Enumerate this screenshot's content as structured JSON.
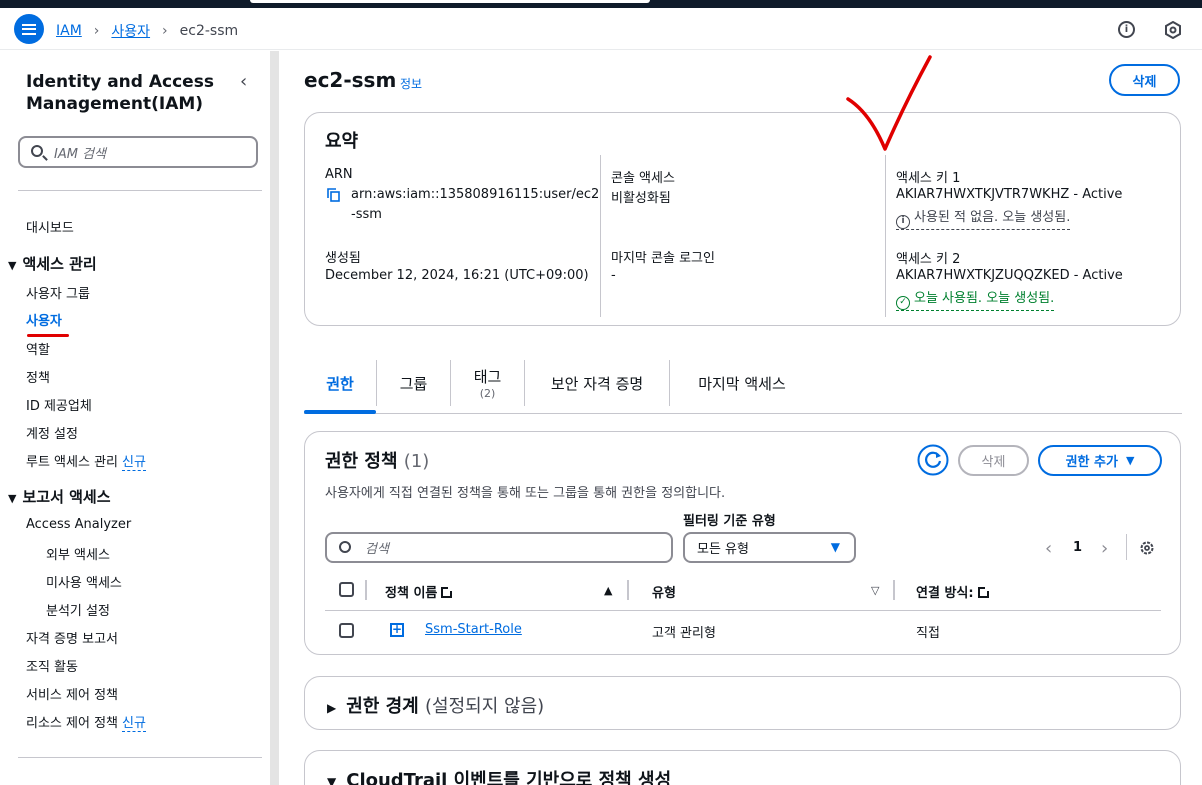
{
  "breadcrumb": {
    "iam": "IAM",
    "users": "사용자",
    "current": "ec2-ssm"
  },
  "sidebar": {
    "title": "Identity and Access Management(IAM)",
    "search_placeholder": "IAM 검색",
    "dashboard": "대시보드",
    "access_mgmt": "액세스 관리",
    "user_groups": "사용자 그룹",
    "users": "사용자",
    "roles": "역할",
    "policies": "정책",
    "id_providers": "ID 제공업체",
    "account_settings": "계정 설정",
    "root_access": "루트 액세스 관리",
    "new_label": "신규",
    "reports": "보고서 액세스",
    "access_analyzer": "Access Analyzer",
    "external_access": "외부 액세스",
    "unused_access": "미사용 액세스",
    "analyzer_settings": "분석기 설정",
    "cred_report": "자격 증명 보고서",
    "org_activity": "조직 활동",
    "scp": "서비스 제어 정책",
    "rcp": "리소스 제어 정책",
    "rcp_new": "신규"
  },
  "page": {
    "title": "ec2-ssm",
    "info": "정보",
    "delete": "삭제"
  },
  "summary": {
    "title": "요약",
    "arn_label": "ARN",
    "arn_value_1": "arn:aws:iam::135808916115:user/ec2",
    "arn_value_2": "-ssm",
    "created_label": "생성됨",
    "created_value": "December 12, 2024, 16:21 (UTC+09:00)",
    "console_label": "콘솔 액세스",
    "console_value": "비활성화됨",
    "last_login_label": "마지막 콘솔 로그인",
    "last_login_value": "-",
    "key1_label": "액세스 키 1",
    "key1_value": "AKIAR7HWXTKJVTR7WKHZ - Active",
    "key1_status": "사용된 적 없음. 오늘 생성됨.",
    "key2_label": "액세스 키 2",
    "key2_value": "AKIAR7HWXTKJZUQQZKED - Active",
    "key2_status": "오늘 사용됨. 오늘 생성됨."
  },
  "tabs": [
    {
      "label": "권한"
    },
    {
      "label": "그룹"
    },
    {
      "label": "태그",
      "count": "(2)"
    },
    {
      "label": "보안 자격 증명"
    },
    {
      "label": "마지막 액세스"
    }
  ],
  "policies": {
    "title": "권한 정책",
    "count": "(1)",
    "delete": "삭제",
    "add": "권한 추가",
    "description": "사용자에게 직접 연결된 정책을 통해 또는 그룹을 통해 권한을 정의합니다.",
    "filter_label": "필터링 기준 유형",
    "search_placeholder": "검색",
    "filter_value": "모든 유형",
    "page": "1",
    "col_name": "정책 이름",
    "col_type": "유형",
    "col_attach": "연결 방식:",
    "rows": [
      {
        "name": "Ssm-Start-Role",
        "type": "고객 관리형",
        "attach": "직접"
      }
    ]
  },
  "boundary": {
    "title": "권한 경계",
    "note": "(설정되지 않음)"
  },
  "cloudtrail": {
    "title": "CloudTrail 이벤트를 기반으로 정책 생성"
  },
  "colors": {
    "accent": "#006ce0",
    "success": "#00802f",
    "annotation": "#e00000"
  }
}
